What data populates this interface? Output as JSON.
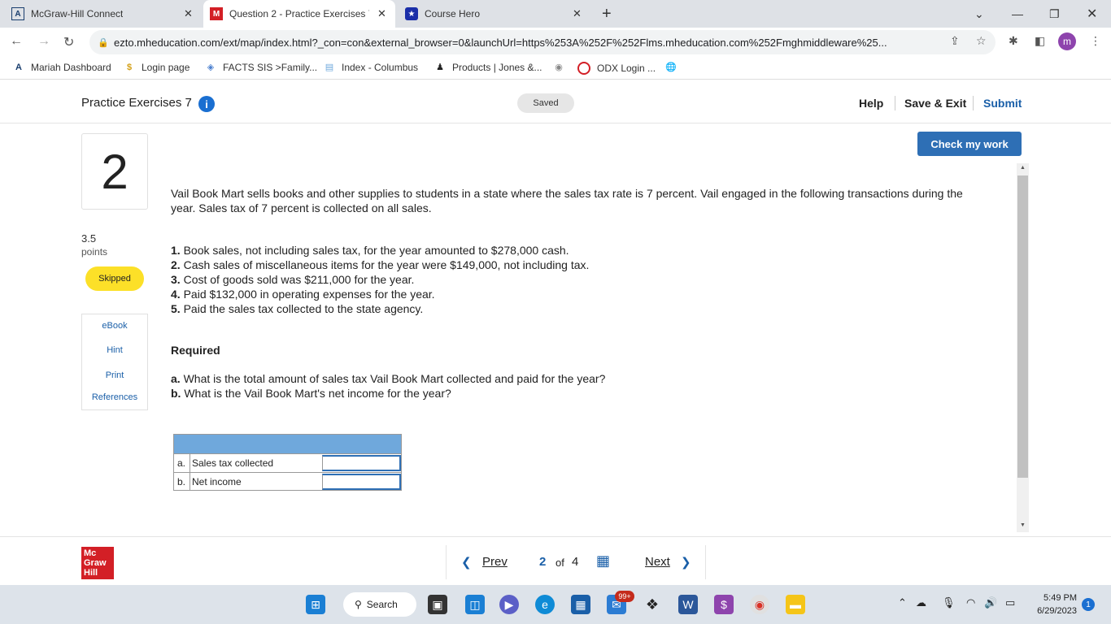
{
  "browser": {
    "tabs": [
      {
        "title": "McGraw-Hill Connect",
        "close": "✕"
      },
      {
        "title": "Question 2 - Practice Exercises 7",
        "close": "✕"
      },
      {
        "title": "Course Hero",
        "close": "✕"
      }
    ],
    "new_tab": "+",
    "url": "ezto.mheducation.com/ext/map/index.html?_con=con&external_browser=0&launchUrl=https%253A%252F%252Flms.mheducation.com%252Fmghmiddleware%25...",
    "profile_initial": "m",
    "bookmarks": [
      "Mariah Dashboard",
      "Login page",
      "FACTS SIS >Family...",
      "Index - Columbus",
      "Products | Jones &...",
      "ODX Login ..."
    ]
  },
  "header": {
    "title": "Practice Exercises 7",
    "saved": "Saved",
    "help": "Help",
    "save_exit": "Save & Exit",
    "submit": "Submit"
  },
  "sidebar": {
    "question_number": "2",
    "points_value": "3.5",
    "points_label": "points",
    "status": "Skipped",
    "tools": [
      "eBook",
      "Hint",
      "Print",
      "References"
    ]
  },
  "main": {
    "check_button": "Check my work",
    "intro": "Vail Book Mart sells books and other supplies to students in a state where the sales tax rate is 7 percent. Vail engaged in the following transactions during the year. Sales tax of 7 percent is collected on all sales.",
    "transactions": [
      {
        "num": "1.",
        "text": "Book sales, not including sales tax, for the year amounted to $278,000 cash."
      },
      {
        "num": "2.",
        "text": "Cash sales of miscellaneous items for the year were $149,000, not including tax."
      },
      {
        "num": "3.",
        "text": "Cost of goods sold was $211,000 for the year."
      },
      {
        "num": "4.",
        "text": "Paid $132,000 in operating expenses for the year."
      },
      {
        "num": "5.",
        "text": "Paid the sales tax collected to the state agency."
      }
    ],
    "required_heading": "Required",
    "requirements": [
      {
        "num": "a.",
        "text": "What is the total amount of sales tax Vail Book Mart collected and paid for the year?"
      },
      {
        "num": "b.",
        "text": "What is the Vail Book Mart's net income for the year?"
      }
    ],
    "answer_rows": [
      {
        "letter": "a.",
        "label": "Sales tax collected",
        "value": ""
      },
      {
        "letter": "b.",
        "label": "Net income",
        "value": ""
      }
    ]
  },
  "footer": {
    "logo": "Mc Graw Hill",
    "prev": "Prev",
    "current": "2",
    "of": "of",
    "total": "4",
    "next": "Next"
  },
  "taskbar": {
    "search": "Search",
    "mail_badge": "99+",
    "time": "5:49 PM",
    "date": "6/29/2023",
    "notifications": "1"
  },
  "colors": {
    "accent": "#2e6fb5",
    "skipped": "#fce028",
    "table_header": "#6fa8dc",
    "brand_red": "#d31f26"
  }
}
